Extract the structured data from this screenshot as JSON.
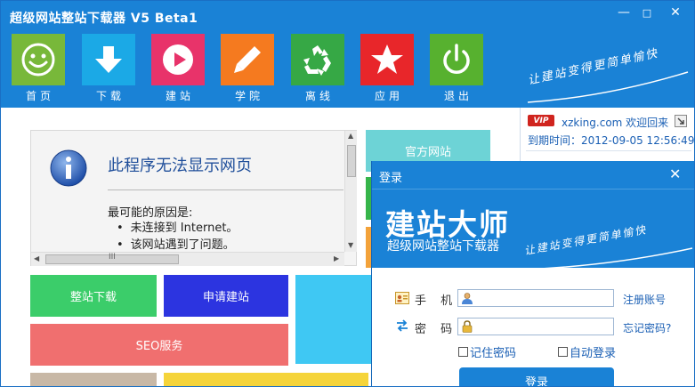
{
  "window": {
    "title": "超级网站整站下载器 V5 Beta1",
    "min_glyph": "—",
    "max_glyph": "□",
    "close_glyph": "✕"
  },
  "nav": {
    "items": [
      {
        "label": "首页",
        "icon": "smiley-icon"
      },
      {
        "label": "下载",
        "icon": "download-arrow-icon"
      },
      {
        "label": "建站",
        "icon": "play-icon"
      },
      {
        "label": "学院",
        "icon": "pencil-icon"
      },
      {
        "label": "离线",
        "icon": "recycle-icon"
      },
      {
        "label": "应用",
        "icon": "star-icon"
      },
      {
        "label": "退出",
        "icon": "power-icon"
      }
    ],
    "slogan": "让建站变得更简单愉快"
  },
  "browser_error": {
    "title": "此程序无法显示网页",
    "reason": "最可能的原因是:",
    "bullets": [
      "未连接到 Internet。",
      "该网站遇到了问题。"
    ],
    "grip": "III"
  },
  "tiles": {
    "official": "官方网站",
    "download": "整站下载",
    "apply": "申请建站",
    "seo": "SEO服务"
  },
  "user_info": {
    "vip": "VIP",
    "welcome": "xzking.com 欢迎回来",
    "expire": "到期时间：2012-09-05 12:56:49"
  },
  "login": {
    "title": "登录",
    "close_glyph": "✕",
    "brand": "建站大师",
    "brand_sub": "超级网站整站下载器",
    "slogan": "让建站变得更简单愉快",
    "phone_label": "手 机:",
    "password_label": "密 码:",
    "phone_value": "",
    "password_value": "",
    "register_link": "注册账号",
    "forgot_link": "忘记密码?",
    "remember": "记住密码",
    "auto_login": "自动登录",
    "submit": "登录"
  },
  "colors": {
    "header_blue": "#1a82d6",
    "link_blue": "#1a5fb4"
  }
}
